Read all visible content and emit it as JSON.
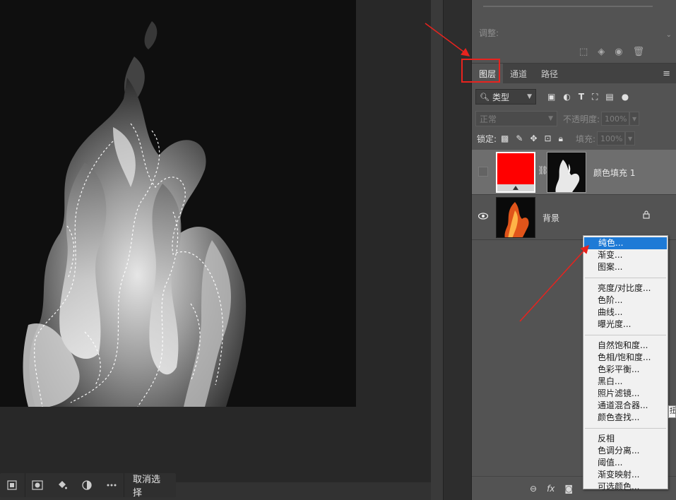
{
  "canvas": {
    "task_bar": {
      "deselect_label": "取消选择"
    }
  },
  "properties": {
    "adjust_label": "调整:"
  },
  "layers_panel": {
    "tabs": [
      {
        "label": "图层",
        "active": true
      },
      {
        "label": "通道",
        "active": false
      },
      {
        "label": "路径",
        "active": false
      }
    ],
    "filter": {
      "label": "类型"
    },
    "blend_mode": "正常",
    "opacity_label": "不透明度:",
    "opacity_value": "100%",
    "lock_label": "锁定:",
    "fill_label": "填充:",
    "fill_value": "100%",
    "layers": [
      {
        "name": "颜色填充 1",
        "visible": false,
        "selected": true,
        "fill_color": "#ff0000"
      },
      {
        "name": "背景",
        "visible": true,
        "selected": false,
        "locked": true
      }
    ]
  },
  "fill_menu": {
    "groups": [
      [
        "纯色...",
        "渐变...",
        "图案..."
      ],
      [
        "亮度/对比度...",
        "色阶...",
        "曲线...",
        "曝光度..."
      ],
      [
        "自然饱和度...",
        "色相/饱和度...",
        "色彩平衡...",
        "黑白...",
        "照片滤镜...",
        "通道混合器...",
        "颜色查找..."
      ],
      [
        "反相",
        "色调分离...",
        "阈值...",
        "渐变映射...",
        "可选颜色..."
      ]
    ],
    "highlighted": "纯色...",
    "highlight_color": "#1e7ad6",
    "overflow_glyph": "扭"
  },
  "annotation_color": "#e8231e"
}
